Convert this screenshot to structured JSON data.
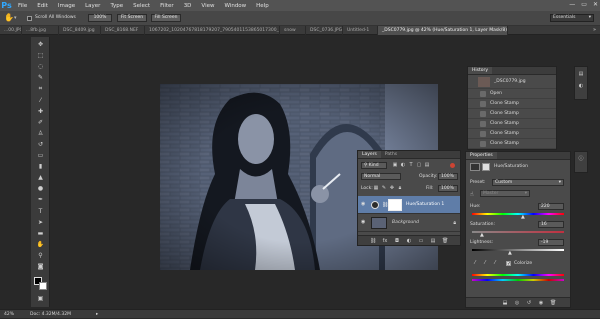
{
  "app": {
    "logo": "Ps",
    "menu": [
      "File",
      "Edit",
      "Image",
      "Layer",
      "Type",
      "Select",
      "Filter",
      "3D",
      "View",
      "Window",
      "Help"
    ],
    "window_controls": [
      "—",
      "▭",
      "✕"
    ]
  },
  "options": {
    "scroll_all_label": "Scroll All Windows",
    "zoom_buttons": [
      "100%",
      "Fit Screen",
      "Fill Screen"
    ],
    "workspace": "Essentials"
  },
  "tabs": [
    {
      "label": "...00.JPG",
      "active": false
    },
    {
      "label": "...8fb.jpg",
      "active": false
    },
    {
      "label": "DSC_8409.jpg",
      "active": false
    },
    {
      "label": "DSC_8168.NEF",
      "active": false
    },
    {
      "label": "1067202_10204767818179207_7905401153865017300_n.jpg",
      "active": false
    },
    {
      "label": "snow",
      "active": false
    },
    {
      "label": "DSC_0736.JPG",
      "active": false
    },
    {
      "label": "Untitled-1",
      "active": false
    },
    {
      "label": "_DSC0779.jpg @ 42% (Hue/Saturation 1, Layer Mask/8) *",
      "active": true
    }
  ],
  "history": {
    "tab": "History",
    "snapshot": "_DSC0779.jpg",
    "items": [
      "Open",
      "Clone Stamp",
      "Clone Stamp",
      "Clone Stamp",
      "Clone Stamp",
      "Clone Stamp",
      "Clone Stamp"
    ]
  },
  "layers": {
    "tabs": [
      "Layers",
      "Paths"
    ],
    "filter": "Kind",
    "blend_mode": "Normal",
    "opacity_label": "Opacity:",
    "opacity": "100%",
    "lock_label": "Lock:",
    "fill_label": "Fill:",
    "fill": "100%",
    "items": [
      {
        "name": "Hue/Saturation 1",
        "italic": false,
        "selected": true
      },
      {
        "name": "Background",
        "italic": true,
        "selected": false
      }
    ],
    "footer_icons": [
      "link-icon",
      "fx-icon",
      "mask-icon",
      "adjustment-icon",
      "folder-icon",
      "new-layer-icon",
      "trash-icon"
    ]
  },
  "properties": {
    "tab": "Properties",
    "title": "Hue/Saturation",
    "preset_label": "Preset:",
    "preset": "Custom",
    "channel": "Master",
    "hue_label": "Hue:",
    "hue": "220",
    "saturation_label": "Saturation:",
    "saturation": "16",
    "lightness_label": "Lightness:",
    "lightness": "-19",
    "colorize_label": "Colorize",
    "colorize": true,
    "accent_color": "#1e6fd9"
  },
  "status": {
    "zoom": "42%",
    "doc": "Doc: 4.32M/4.32M"
  }
}
